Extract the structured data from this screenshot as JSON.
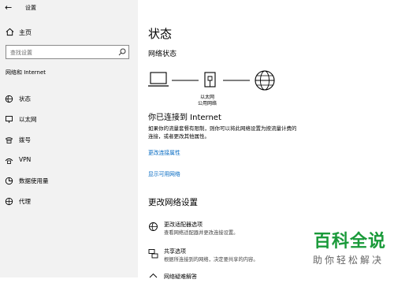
{
  "window": {
    "back_icon": "back-arrow-icon",
    "title": "设置"
  },
  "sidebar": {
    "home_label": "主页",
    "search_placeholder": "查找设置",
    "section_title": "网络和 Internet",
    "items": [
      {
        "label": "状态",
        "icon": "status-icon"
      },
      {
        "label": "以太网",
        "icon": "ethernet-icon"
      },
      {
        "label": "拨号",
        "icon": "dialup-icon"
      },
      {
        "label": "VPN",
        "icon": "vpn-icon"
      },
      {
        "label": "数据使用量",
        "icon": "data-usage-icon"
      },
      {
        "label": "代理",
        "icon": "proxy-icon"
      }
    ]
  },
  "main": {
    "title": "状态",
    "network_status_label": "网络状态",
    "diagram": {
      "adapter_name": "以太网",
      "network_type": "公用网络"
    },
    "connected_title": "你已连接到 Internet",
    "description_line1": "如果你的流量套餐有限制，则你可以将此网络设置为按流量计费的",
    "description_line2": "连接，或者更改其他属性。",
    "link_change_properties": "更改连接属性",
    "link_show_networks": "显示可用网络",
    "change_settings_title": "更改网络设置",
    "options": [
      {
        "title": "更改适配器选项",
        "desc": "查看网络适配器并更改连接设置。",
        "icon": "adapter-icon"
      },
      {
        "title": "共享选项",
        "desc": "根据所连接到的网络，决定要共享的内容。",
        "icon": "sharing-icon"
      },
      {
        "title": "网络疑难解答",
        "icon": "troubleshoot-icon"
      }
    ]
  },
  "watermark": {
    "line1": "百科全说",
    "line2": "助你轻松解决"
  },
  "colors": {
    "sidebar_bg": "#f2f2f2",
    "link": "#0067c0",
    "watermark": "#1a9a3a"
  }
}
